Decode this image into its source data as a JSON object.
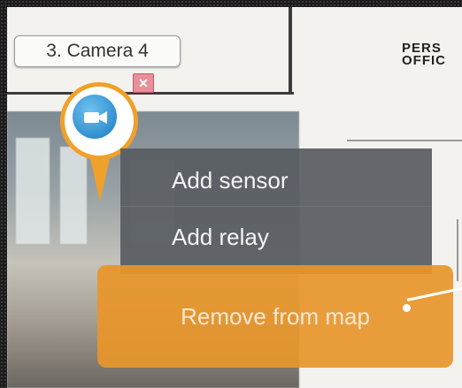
{
  "camera_label": "3. Camera 4",
  "close_glyph": "✕",
  "map_text": "PERS\nOFFIC",
  "context_menu": {
    "items": [
      "Add sensor",
      "Add relay"
    ],
    "remove_label": "Remove from map"
  },
  "colors": {
    "accent_orange": "#f0a12a",
    "menu_bg": "#585c62",
    "camera_blue": "#1879c2"
  },
  "icons": {
    "pin": "map-pin-icon",
    "camera": "video-camera-icon",
    "close": "close-icon"
  }
}
